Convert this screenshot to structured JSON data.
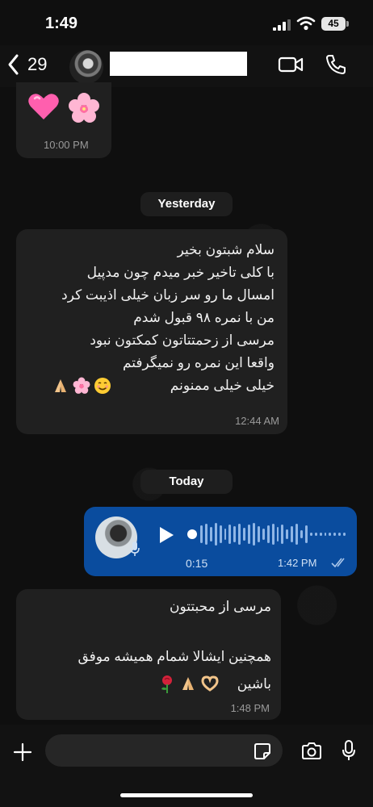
{
  "status_bar": {
    "time": "1:49",
    "battery": "45"
  },
  "header": {
    "back_count": "29"
  },
  "messages": {
    "m1": {
      "time": "10:00 PM"
    },
    "m2": {
      "lines": [
        "سلام شبتون بخیر",
        "با کلی تاخیر خبر میدم چون مدپیل",
        "امسال ما رو سر زبان خیلی اذیبت کرد",
        "من با نمره ۹۸ قبول شدم",
        "مرسی از زحمتتاتون کمکتون نبود",
        "واقعا این نمره رو نمیگرفتم",
        "خیلی خیلی ممنونم"
      ],
      "time": "12:44 AM"
    },
    "voice": {
      "duration": "0:15",
      "time": "1:42 PM"
    },
    "m3": {
      "lines": [
        "مرسی از محبتتون",
        "",
        "همچنین ایشالا شمام همیشه موفق",
        "باشین"
      ],
      "time": "1:48 PM"
    }
  },
  "dates": {
    "yesterday": "Yesterday",
    "today": "Today"
  },
  "composer": {
    "placeholder": ""
  },
  "colors": {
    "outgoing": "#0a4c9e",
    "incoming": "#202020"
  }
}
